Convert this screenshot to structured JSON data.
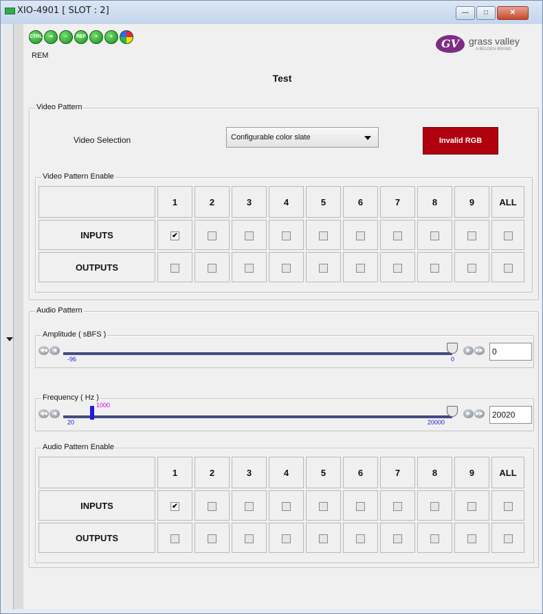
{
  "window": {
    "title": "XIO-4901 [ SLOT : 2]",
    "buttons": [
      "—",
      "□",
      "✕"
    ]
  },
  "toolbar": {
    "icons": [
      {
        "name": "ctrl-icon",
        "text": "CTRL"
      },
      {
        "name": "arrow-right-icon",
        "text": "➔"
      },
      {
        "name": "minus-icon",
        "text": "−"
      },
      {
        "name": "ref-icon",
        "text": "REF"
      },
      {
        "name": "tree-icon",
        "text": "≡"
      },
      {
        "name": "plus-icon",
        "text": "+"
      },
      {
        "name": "color-wheel-icon",
        "text": ""
      }
    ],
    "rem_label": "REM"
  },
  "logo": {
    "mark": "GV",
    "text": "grass valley",
    "sub": "A BELDEN BRAND"
  },
  "page_title": "Test",
  "video_pattern": {
    "legend": "Video Pattern",
    "selection_label": "Video Selection",
    "selection_value": "Configurable color slate",
    "status_button": "Invalid RGB",
    "enable": {
      "legend": "Video Pattern Enable",
      "columns": [
        "1",
        "2",
        "3",
        "4",
        "5",
        "6",
        "7",
        "8",
        "9",
        "ALL"
      ],
      "rows": [
        {
          "label": "INPUTS",
          "checked": [
            true,
            false,
            false,
            false,
            false,
            false,
            false,
            false,
            false,
            false
          ]
        },
        {
          "label": "OUTPUTS",
          "checked": [
            false,
            false,
            false,
            false,
            false,
            false,
            false,
            false,
            false,
            false
          ]
        }
      ]
    }
  },
  "audio_pattern": {
    "legend": "Audio Pattern",
    "amplitude": {
      "legend": "Amplitude ( sBFS )",
      "min": "-96",
      "max": "0",
      "value": "0"
    },
    "frequency": {
      "legend": "Frequency ( Hz )",
      "min": "20",
      "max": "20000",
      "marker": "1000",
      "value": "20020"
    },
    "enable": {
      "legend": "Audio Pattern Enable",
      "columns": [
        "1",
        "2",
        "3",
        "4",
        "5",
        "6",
        "7",
        "8",
        "9",
        "ALL"
      ],
      "rows": [
        {
          "label": "INPUTS",
          "checked": [
            true,
            false,
            false,
            false,
            false,
            false,
            false,
            false,
            false,
            false
          ]
        },
        {
          "label": "OUTPUTS",
          "checked": [
            false,
            false,
            false,
            false,
            false,
            false,
            false,
            false,
            false,
            false
          ]
        }
      ]
    }
  },
  "colors": {
    "status_red": "#b0000e",
    "slider_track": "#4a4e8a",
    "marker_blue": "#1d1ae0",
    "marker_magenta": "#d900d9"
  }
}
